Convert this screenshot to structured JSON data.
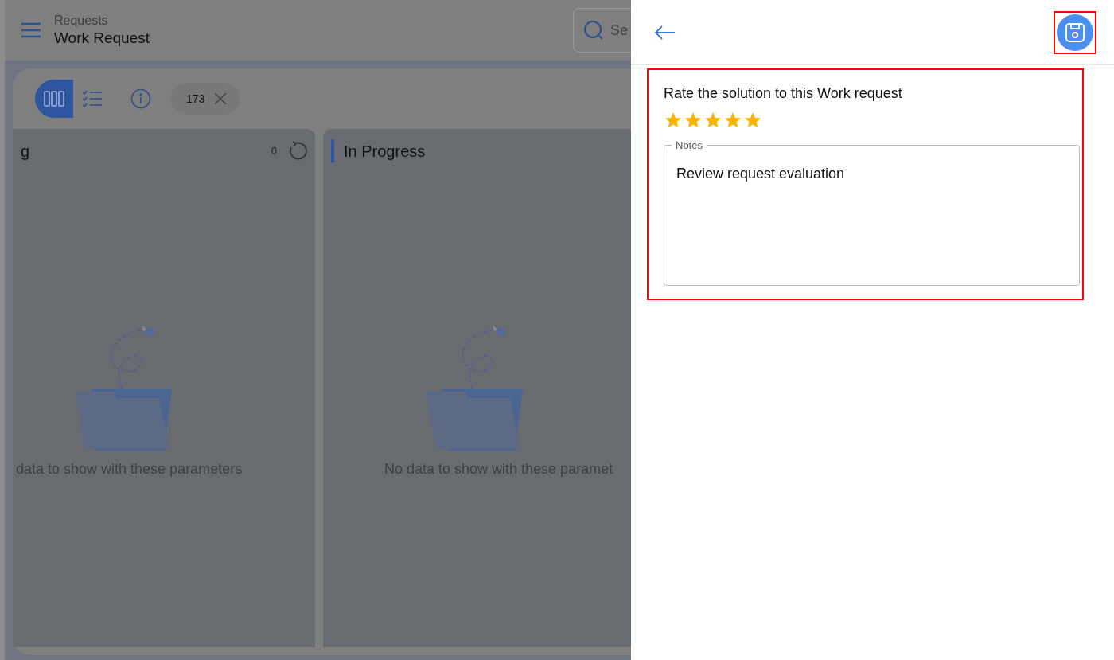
{
  "header": {
    "breadcrumb": "Requests",
    "title": "Work Request",
    "search": {
      "placeholder": "Se"
    }
  },
  "toolbar": {
    "views": [
      {
        "kind": "board",
        "selected": true
      },
      {
        "kind": "list",
        "selected": false
      }
    ],
    "filter_chip": "173"
  },
  "columns": [
    {
      "title": "g",
      "count": "0",
      "empty_message": "data to show with these parameters"
    },
    {
      "title": "In Progress",
      "color": "#2f55a0",
      "empty_message": "No data to show with these paramet"
    }
  ],
  "panel": {
    "question": "Rate the solution to this Work request",
    "stars": 5,
    "notes": {
      "label": "Notes",
      "value": "Review request evaluation"
    }
  }
}
